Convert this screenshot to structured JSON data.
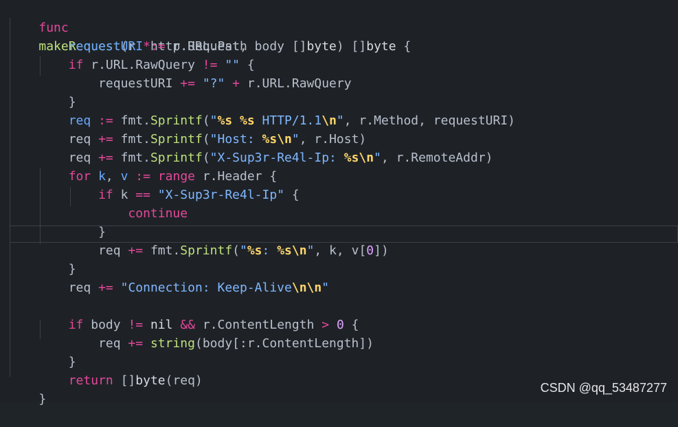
{
  "code": {
    "lines": [
      "func makeRequest(r *http.Request, body []byte) []byte {",
      "    requestURI := r.URL.Path",
      "    if r.URL.RawQuery != \"\" {",
      "        requestURI += \"?\" + r.URL.RawQuery",
      "    }",
      "    req := fmt.Sprintf(\"%s %s HTTP/1.1\\n\", r.Method, requestURI)",
      "    req += fmt.Sprintf(\"Host: %s\\n\", r.Host)",
      "    req += fmt.Sprintf(\"X-Sup3r-Re4l-Ip: %s\\n\", r.RemoteAddr)",
      "    for k, v := range r.Header {",
      "        if k == \"X-Sup3r-Re4l-Ip\" {",
      "            continue",
      "        }",
      "        req += fmt.Sprintf(\"%s: %s\\n\", k, v[0])",
      "    }",
      "    req += \"Connection: Keep-Alive\\n\\n\"",
      "",
      "    if body != nil && r.ContentLength > 0 {",
      "        req += string(body[:r.ContentLength])",
      "    }",
      "    return []byte(req)",
      "}"
    ]
  },
  "watermark": {
    "text": "CSDN @qq_53487277"
  }
}
